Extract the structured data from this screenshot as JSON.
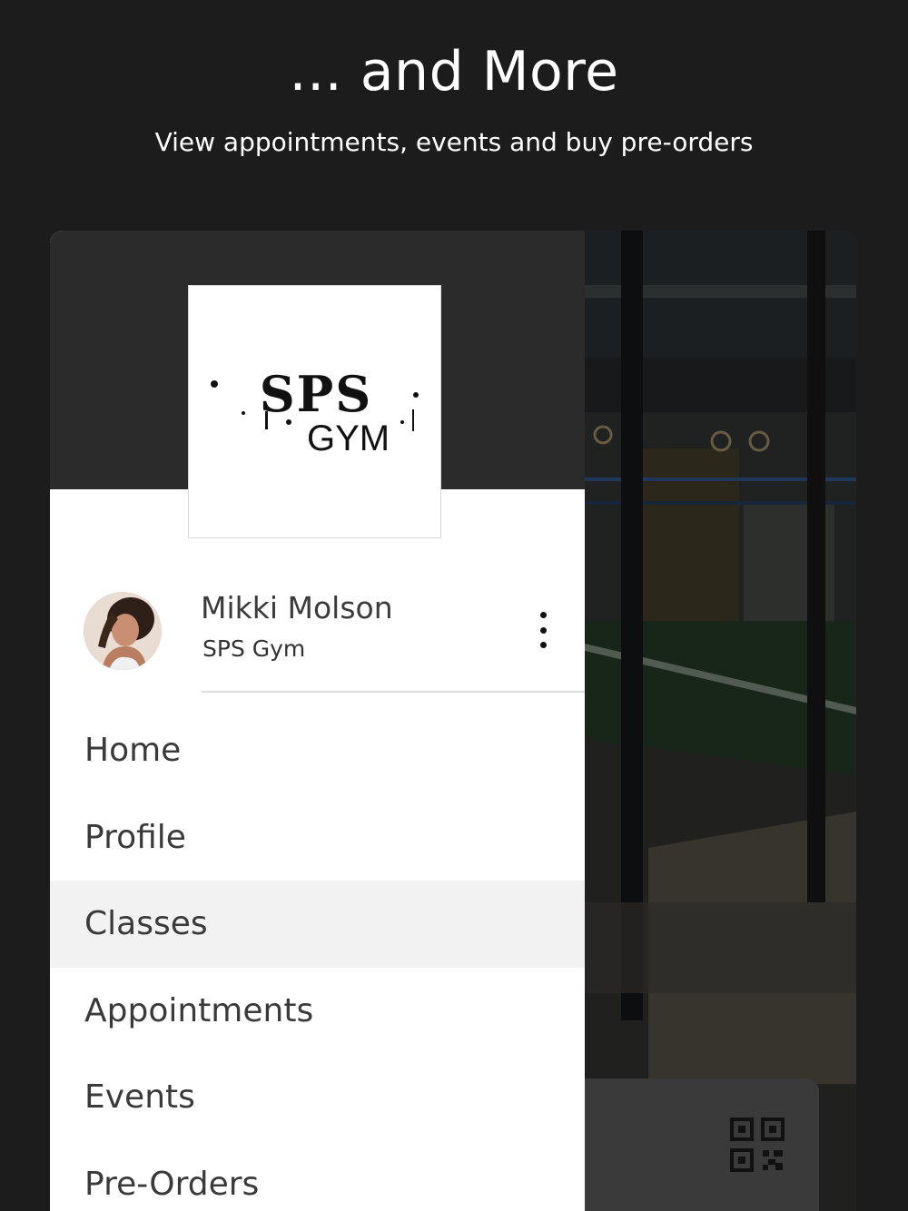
{
  "headline": "... and More",
  "subheadline": "View appointments, events and buy pre-orders",
  "logo": {
    "text_top": "SPS",
    "text_bottom": "GYM"
  },
  "user": {
    "name": "Mikki Molson",
    "gym": "SPS Gym"
  },
  "menu": {
    "items": [
      {
        "label": "Home",
        "active": false
      },
      {
        "label": "Profile",
        "active": false
      },
      {
        "label": "Classes",
        "active": true
      },
      {
        "label": "Appointments",
        "active": false
      },
      {
        "label": "Events",
        "active": false
      },
      {
        "label": "Pre-Orders",
        "active": false
      }
    ]
  },
  "icons": {
    "more": "more-vertical-icon",
    "qr": "qr-code-icon",
    "avatar": "user-avatar"
  },
  "colors": {
    "background": "#1c1c1c",
    "drawer_header": "#2b2b2b",
    "active_item": "#f2f2f2",
    "text": "#3a3a3a"
  }
}
